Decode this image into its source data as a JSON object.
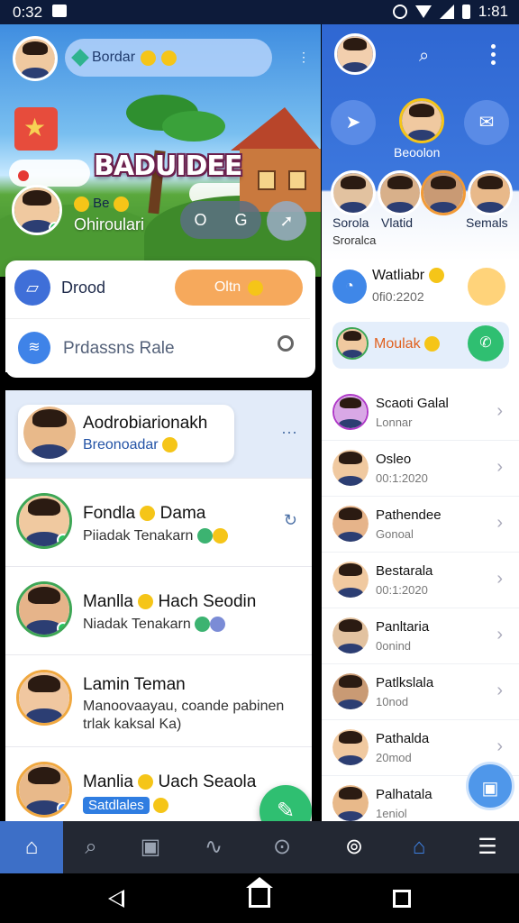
{
  "status_bar": {
    "time_left": "0:32",
    "time_right": "1:81"
  },
  "left": {
    "top_search": "Bordar",
    "game_title": "BADUIDEE",
    "me": {
      "line1": "Be",
      "line2": "Ohiroulari",
      "ctrl_a": "O",
      "ctrl_b": "G"
    },
    "card": {
      "drood_label": "Drood",
      "orange_pill": "Oltn",
      "search_text": "Prdassns Rale"
    },
    "chats": [
      {
        "name": "Aodrobiarionakh",
        "preview": "Breonoadar",
        "highlight": true
      },
      {
        "name": "Fondla",
        "name2": "Dama",
        "preview": "Piiadak Tenakarn"
      },
      {
        "name": "Manlla",
        "name2": "Hach Seodin",
        "preview": "Niadak Tenakarn"
      },
      {
        "name": "Lamin Teman",
        "preview": "Manoovaayau, coande pabinen",
        "preview2": "trlak kaksal Ka)"
      },
      {
        "name": "Manlia",
        "name2": "Uach Seaola",
        "preview": "Satdlales"
      }
    ]
  },
  "right": {
    "story_name": "Beoolon",
    "stories": [
      {
        "label": "Sorola"
      },
      {
        "label": "Vlatid"
      },
      {
        "label": ""
      },
      {
        "label": "Semals"
      }
    ],
    "sub_label": "Sroralca",
    "card1": {
      "title": "Watliabr",
      "subtitle": "0fi0:2202"
    },
    "card2": {
      "title": "Moulak"
    },
    "items": [
      {
        "name": "Scaoti Galal",
        "sub": "Lonnar"
      },
      {
        "name": "Osleo",
        "sub": "00:1:2020"
      },
      {
        "name": "Pathendee",
        "sub": "Gonoal"
      },
      {
        "name": "Bestarala",
        "sub": "00:1:2020"
      },
      {
        "name": "Panltaria",
        "sub": "0onind"
      },
      {
        "name": "Patlkslala",
        "sub": "10nod"
      },
      {
        "name": "Pathalda",
        "sub": "20mod"
      },
      {
        "name": "Palhatala",
        "sub": "1eniol"
      }
    ]
  },
  "colors": {
    "accent": "#3d6fc7",
    "green": "#2fbf71",
    "orange": "#f6a95c",
    "nav_bg": "#232833"
  },
  "icons": [
    "home-icon",
    "search-icon",
    "inbox-icon",
    "activity-icon",
    "location-icon",
    "search-bubble-icon",
    "home-icon-right",
    "menu-icon"
  ]
}
